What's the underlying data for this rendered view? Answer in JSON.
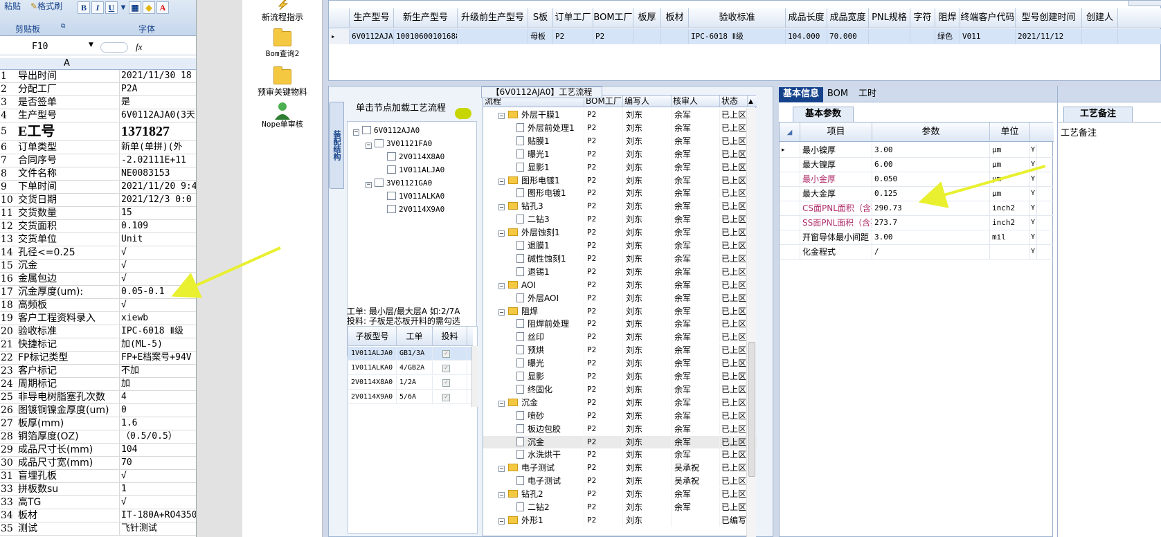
{
  "excel": {
    "ribbon": {
      "paste_label": "粘贴",
      "format_painter": "格式刷",
      "clipboard_group": "剪贴板",
      "font_group": "字体",
      "bold": "B",
      "italic": "I",
      "underline": "U"
    },
    "name_box": "F10",
    "fx": "fx",
    "col_a": "A",
    "rows": [
      {
        "n": "1",
        "a": "导出时间",
        "b": "2021/11/30 18"
      },
      {
        "n": "2",
        "a": "分配工厂",
        "b": "P2A"
      },
      {
        "n": "3",
        "a": "是否签单",
        "b": "是"
      },
      {
        "n": "4",
        "a": "生产型号",
        "b": "6V0112AJA0(3天"
      },
      {
        "n": "5",
        "a": "E工号",
        "b": "1371827"
      },
      {
        "n": "6",
        "a": "订单类型",
        "b": "新单(单拼)(外"
      },
      {
        "n": "7",
        "a": "合同序号",
        "b": "-2.02111E+11"
      },
      {
        "n": "8",
        "a": "文件名称",
        "b": "NE0083153"
      },
      {
        "n": "9",
        "a": "下单时间",
        "b": "2021/11/20 9:4"
      },
      {
        "n": "10",
        "a": "交货日期",
        "b": "2021/12/3 0:0"
      },
      {
        "n": "11",
        "a": "交货数量",
        "b": "15"
      },
      {
        "n": "12",
        "a": "交货面积",
        "b": "0.109"
      },
      {
        "n": "13",
        "a": "交货单位",
        "b": "Unit"
      },
      {
        "n": "14",
        "a": "孔径<=0.25",
        "b": "√"
      },
      {
        "n": "15",
        "a": "沉金",
        "b": "√"
      },
      {
        "n": "16",
        "a": "金属包边",
        "b": "√"
      },
      {
        "n": "17",
        "a": "沉金厚度(um):",
        "b": "0.05-0.1"
      },
      {
        "n": "18",
        "a": "高频板",
        "b": "√"
      },
      {
        "n": "19",
        "a": "客户工程资料录入",
        "b": "xiewb"
      },
      {
        "n": "20",
        "a": "验收标准",
        "b": "IPC-6018 Ⅱ级"
      },
      {
        "n": "21",
        "a": "快捷标记",
        "b": "加(ML-5)"
      },
      {
        "n": "22",
        "a": "FP标记类型",
        "b": "FP+E档案号+94V"
      },
      {
        "n": "23",
        "a": "客户标记",
        "b": "不加"
      },
      {
        "n": "24",
        "a": "周期标记",
        "b": "加"
      },
      {
        "n": "25",
        "a": "非导电树脂塞孔次数",
        "b": "4"
      },
      {
        "n": "26",
        "a": "图镀铜镍金厚度(um)",
        "b": "0"
      },
      {
        "n": "27",
        "a": "板厚(mm)",
        "b": "1.6"
      },
      {
        "n": "28",
        "a": "铜箔厚度(OZ)",
        "b": "（0.5/0.5）"
      },
      {
        "n": "29",
        "a": "成品尺寸长(mm)",
        "b": "104"
      },
      {
        "n": "30",
        "a": "成品尺寸宽(mm)",
        "b": "70"
      },
      {
        "n": "31",
        "a": "盲埋孔板",
        "b": "√"
      },
      {
        "n": "33",
        "a": "拼板数su",
        "b": "1"
      },
      {
        "n": "33",
        "a": "高TG",
        "b": "√"
      },
      {
        "n": "34",
        "a": "板材",
        "b": "IT-180A+RO4350"
      },
      {
        "n": "35",
        "a": "测试",
        "b": "飞针测试"
      }
    ]
  },
  "nav": {
    "items": [
      {
        "label": "新流程指示",
        "icon": "lightning-icon"
      },
      {
        "label": "Bom查询2",
        "icon": "folder-icon"
      },
      {
        "label": "预审关键物料",
        "icon": "folder-icon"
      },
      {
        "label": "Nope单审核",
        "icon": "user-icon"
      }
    ]
  },
  "top_grid": {
    "headers": [
      "生产型号",
      "新生产型号",
      "升级前生产型号",
      "S板",
      "订单工厂",
      "BOM工厂",
      "板厚",
      "板材",
      "验收标准",
      "成品长度",
      "成品宽度",
      "PNL规格",
      "字符",
      "阻焊",
      "终端客户代码",
      "型号创建时间",
      "创建人"
    ],
    "row": [
      "6V0112AJA0",
      "10010600101688",
      "",
      "母板",
      "P2",
      "P2",
      "",
      "",
      "IPC-6018 Ⅱ级",
      "104.000",
      "70.000",
      "",
      "",
      "绿色",
      "V011",
      "2021/11/12",
      ""
    ]
  },
  "process": {
    "title": "【6V0112AJA0】工艺流程",
    "vtab": "装配结构",
    "tree_head": "单击节点加载工艺流程",
    "tree": [
      {
        "label": "6V0112AJA0",
        "level": 0
      },
      {
        "label": "3V01121FA0",
        "level": 1
      },
      {
        "label": "2V0114X8A0",
        "level": 2
      },
      {
        "label": "1V011ALJA0",
        "level": 2
      },
      {
        "label": "3V01121GA0",
        "level": 1
      },
      {
        "label": "1V011ALKA0",
        "level": 2
      },
      {
        "label": "2V0114X9A0",
        "level": 2
      }
    ],
    "note_line1": "工单: 最小层/最大层A 如:2/7A",
    "note_line2": "投料: 子板是芯板开料的需勾选",
    "sub_headers": [
      "子板型号",
      "工单",
      "投料"
    ],
    "sub_rows": [
      [
        "1V011ALJA0",
        "GB1/3A"
      ],
      [
        "1V011ALKA0",
        "4/GB2A"
      ],
      [
        "2V0114X8A0",
        "1/2A"
      ],
      [
        "2V0114X9A0",
        "5/6A"
      ]
    ],
    "flow_headers": [
      "流程",
      "BOM工厂",
      "编写人",
      "核审人",
      "状态"
    ],
    "flow_rows": [
      {
        "name": "外层干膜1",
        "type": "folder",
        "bom": "P2",
        "writer": "刘东",
        "reviewer": "余军",
        "status": "已上区"
      },
      {
        "name": "外层前处理1",
        "type": "file",
        "bom": "P2",
        "writer": "刘东",
        "reviewer": "余军",
        "status": "已上区"
      },
      {
        "name": "贴膜1",
        "type": "file",
        "bom": "P2",
        "writer": "刘东",
        "reviewer": "余军",
        "status": "已上区"
      },
      {
        "name": "曝光1",
        "type": "file",
        "bom": "P2",
        "writer": "刘东",
        "reviewer": "余军",
        "status": "已上区"
      },
      {
        "name": "显影1",
        "type": "file",
        "bom": "P2",
        "writer": "刘东",
        "reviewer": "余军",
        "status": "已上区"
      },
      {
        "name": "图形电镀1",
        "type": "folder",
        "bom": "P2",
        "writer": "刘东",
        "reviewer": "余军",
        "status": "已上区"
      },
      {
        "name": "图形电镀1",
        "type": "file",
        "bom": "P2",
        "writer": "刘东",
        "reviewer": "余军",
        "status": "已上区"
      },
      {
        "name": "钻孔3",
        "type": "folder",
        "bom": "P2",
        "writer": "刘东",
        "reviewer": "余军",
        "status": "已上区"
      },
      {
        "name": "二钻3",
        "type": "file",
        "bom": "P2",
        "writer": "刘东",
        "reviewer": "余军",
        "status": "已上区"
      },
      {
        "name": "外层蚀刻1",
        "type": "folder",
        "bom": "P2",
        "writer": "刘东",
        "reviewer": "余军",
        "status": "已上区"
      },
      {
        "name": "退膜1",
        "type": "file",
        "bom": "P2",
        "writer": "刘东",
        "reviewer": "余军",
        "status": "已上区"
      },
      {
        "name": "碱性蚀刻1",
        "type": "file",
        "bom": "P2",
        "writer": "刘东",
        "reviewer": "余军",
        "status": "已上区"
      },
      {
        "name": "退锡1",
        "type": "file",
        "bom": "P2",
        "writer": "刘东",
        "reviewer": "余军",
        "status": "已上区"
      },
      {
        "name": "AOI",
        "type": "folder",
        "bom": "P2",
        "writer": "刘东",
        "reviewer": "余军",
        "status": "已上区"
      },
      {
        "name": "外层AOI",
        "type": "file",
        "bom": "P2",
        "writer": "刘东",
        "reviewer": "余军",
        "status": "已上区"
      },
      {
        "name": "阻焊",
        "type": "folder",
        "bom": "P2",
        "writer": "刘东",
        "reviewer": "余军",
        "status": "已上区"
      },
      {
        "name": "阻焊前处理",
        "type": "file",
        "bom": "P2",
        "writer": "刘东",
        "reviewer": "余军",
        "status": "已上区"
      },
      {
        "name": "丝印",
        "type": "file",
        "bom": "P2",
        "writer": "刘东",
        "reviewer": "余军",
        "status": "已上区"
      },
      {
        "name": "预烘",
        "type": "file",
        "bom": "P2",
        "writer": "刘东",
        "reviewer": "余军",
        "status": "已上区"
      },
      {
        "name": "曝光",
        "type": "file",
        "bom": "P2",
        "writer": "刘东",
        "reviewer": "余军",
        "status": "已上区"
      },
      {
        "name": "显影",
        "type": "file",
        "bom": "P2",
        "writer": "刘东",
        "reviewer": "余军",
        "status": "已上区"
      },
      {
        "name": "终固化",
        "type": "file",
        "bom": "P2",
        "writer": "刘东",
        "reviewer": "余军",
        "status": "已上区"
      },
      {
        "name": "沉金",
        "type": "folder",
        "bom": "P2",
        "writer": "刘东",
        "reviewer": "余军",
        "status": "已上区"
      },
      {
        "name": "喷砂",
        "type": "file",
        "bom": "P2",
        "writer": "刘东",
        "reviewer": "余军",
        "status": "已上区"
      },
      {
        "name": "板边包胶",
        "type": "file",
        "bom": "P2",
        "writer": "刘东",
        "reviewer": "余军",
        "status": "已上区"
      },
      {
        "name": "沉金",
        "type": "file",
        "bom": "P2",
        "writer": "刘东",
        "reviewer": "余军",
        "status": "已上区",
        "selected": true
      },
      {
        "name": "水洗烘干",
        "type": "file",
        "bom": "P2",
        "writer": "刘东",
        "reviewer": "余军",
        "status": "已上区"
      },
      {
        "name": "电子测试",
        "type": "folder",
        "bom": "P2",
        "writer": "刘东",
        "reviewer": "吴承祝",
        "status": "已上区"
      },
      {
        "name": "电子测试",
        "type": "file",
        "bom": "P2",
        "writer": "刘东",
        "reviewer": "吴承祝",
        "status": "已上区"
      },
      {
        "name": "钻孔2",
        "type": "folder",
        "bom": "P2",
        "writer": "刘东",
        "reviewer": "余军",
        "status": "已上区"
      },
      {
        "name": "二钻2",
        "type": "file",
        "bom": "P2",
        "writer": "刘东",
        "reviewer": "余军",
        "status": "已上区"
      },
      {
        "name": "外形1",
        "type": "folder",
        "bom": "P2",
        "writer": "刘东",
        "reviewer": "",
        "status": "已编写"
      }
    ]
  },
  "info": {
    "tabs": [
      "基本信息",
      "BOM",
      "工时"
    ],
    "param_tab": "基本参数",
    "headers": [
      "项目",
      "参数",
      "单位"
    ],
    "rows": [
      {
        "item": "最小镍厚",
        "value": "3.00",
        "unit": "μm",
        "flag": "Y",
        "pink": false
      },
      {
        "item": "最大镍厚",
        "value": "6.00",
        "unit": "μm",
        "flag": "Y",
        "pink": false
      },
      {
        "item": "最小金厚",
        "value": "0.050",
        "unit": "μm",
        "flag": "Y",
        "pink": true
      },
      {
        "item": "最大金厚",
        "value": "0.125",
        "unit": "μm",
        "flag": "Y",
        "pink": false
      },
      {
        "item": "CS面PNL面积（含孔）",
        "value": "290.73",
        "unit": "inch2",
        "flag": "Y",
        "pink": true
      },
      {
        "item": "SS面PNL面积（含孔）",
        "value": "273.7",
        "unit": "inch2",
        "flag": "Y",
        "pink": true
      },
      {
        "item": "开窗导体最小间距",
        "value": "3.00",
        "unit": "mil",
        "flag": "Y",
        "pink": false
      },
      {
        "item": "化金程式",
        "value": "/",
        "unit": "",
        "flag": "Y",
        "pink": false
      }
    ]
  },
  "remark": {
    "tab": "工艺备注",
    "label": "工艺备注"
  },
  "colors": {
    "accent": "#15428b",
    "arrow": "#e8f030",
    "pink": "#b0306c"
  }
}
